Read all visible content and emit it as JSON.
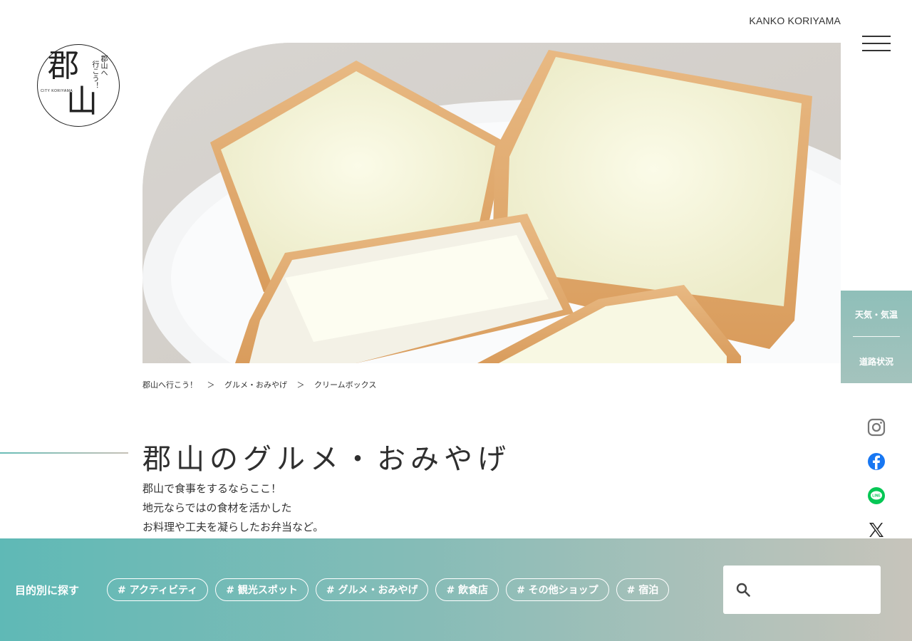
{
  "header": {
    "site_label": "KANKO KORIYAMA",
    "logo": {
      "kanji_top": "郡",
      "kanji_bottom": "山",
      "vertical_1": "郡山へ",
      "vertical_2": "行こう！",
      "tiny": "CITY KORIYAMA"
    }
  },
  "side_panel": {
    "weather_label": "天気・気温",
    "road_label": "道路状況"
  },
  "breadcrumb": [
    {
      "label": "郡山へ行こう！"
    },
    {
      "label": "＞"
    },
    {
      "label": "グルメ・おみやげ"
    },
    {
      "label": "＞"
    },
    {
      "label": "クリームボックス"
    }
  ],
  "page": {
    "title": "郡山のグルメ・おみやげ",
    "intro": [
      "郡山で食事をするならここ！",
      "地元ならではの食材を活かした",
      "お料理や工夫を凝らしたお弁当など。"
    ]
  },
  "social": [
    "instagram-icon",
    "facebook-icon",
    "line-icon",
    "x-icon"
  ],
  "search_bar": {
    "label": "目的別に探す",
    "tags": [
      "# アクティビティ",
      "# 観光スポット",
      "# グルメ・おみやげ",
      "# 飲食店",
      "# その他ショップ",
      "# 宿泊"
    ],
    "input_value": "",
    "placeholder": ""
  },
  "colors": {
    "accent_teal": "#5fb9b6",
    "accent_gray": "#c7c4bb",
    "facebook": "#1877f2",
    "line": "#06c755"
  }
}
